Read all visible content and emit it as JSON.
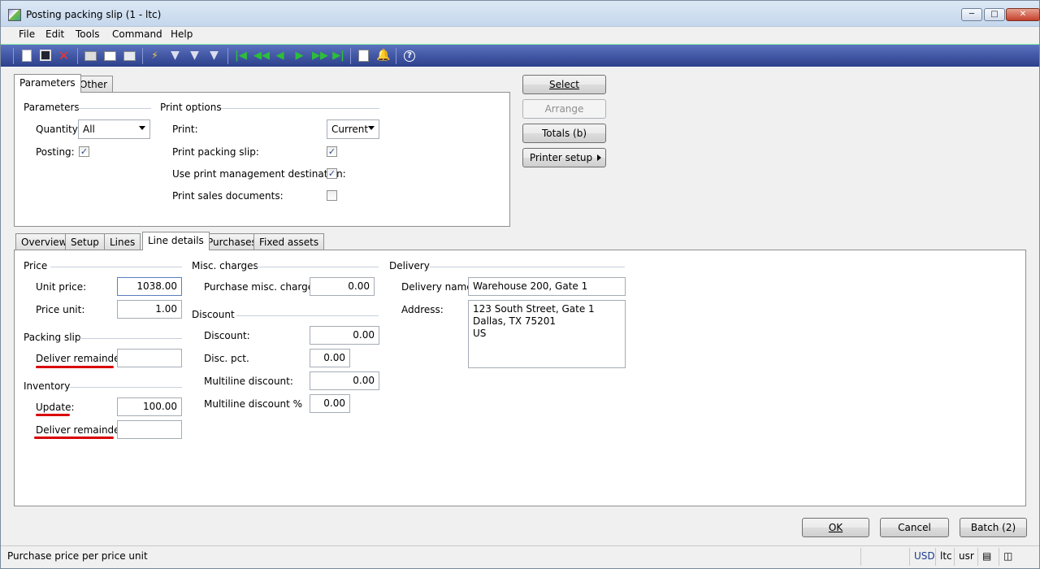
{
  "window": {
    "title": "Posting packing slip (1 - ltc)"
  },
  "menu": [
    "File",
    "Edit",
    "Tools",
    "Command",
    "Help"
  ],
  "top_tabs": {
    "parameters": "Parameters",
    "other": "Other"
  },
  "parameters": {
    "group_label": "Parameters",
    "quantity_label": "Quantity:",
    "quantity_value": "All",
    "posting_label": "Posting:",
    "posting_checked": true
  },
  "print_options": {
    "group_label": "Print options",
    "print_label": "Print:",
    "print_value": "Current",
    "print_packing_slip_label": "Print packing slip:",
    "print_packing_slip_checked": true,
    "use_print_mgmt_label": "Use print management destination:",
    "use_print_mgmt_checked": true,
    "print_sales_docs_label": "Print sales documents:",
    "print_sales_docs_checked": false
  },
  "side_buttons": {
    "select": "Select",
    "arrange": "Arrange",
    "totals": "Totals (b)",
    "printer_setup": "Printer setup"
  },
  "lower_tabs": [
    "Overview",
    "Setup",
    "Lines",
    "Line details",
    "Purchases",
    "Fixed assets"
  ],
  "line_details": {
    "price_group": "Price",
    "unit_price_label": "Unit price:",
    "unit_price_value": "1038.00",
    "price_unit_label": "Price unit:",
    "price_unit_value": "1.00",
    "packing_slip_group": "Packing slip",
    "ps_deliver_remainder_label": "Deliver remainder:",
    "ps_deliver_remainder_value": "",
    "inventory_group": "Inventory",
    "update_label": "Update:",
    "update_value": "100.00",
    "inv_deliver_remainder_label": "Deliver remainder:",
    "inv_deliver_remainder_value": "",
    "misc_group": "Misc. charges",
    "purchase_misc_label": "Purchase misc. charges:",
    "purchase_misc_value": "0.00",
    "discount_group": "Discount",
    "discount_label": "Discount:",
    "discount_value": "0.00",
    "disc_pct_label": "Disc. pct.",
    "disc_pct_value": "0.00",
    "multiline_discount_label": "Multiline discount:",
    "multiline_discount_value": "0.00",
    "multiline_discount_pct_label": "Multiline discount %",
    "multiline_discount_pct_value": "0.00",
    "delivery_group": "Delivery",
    "delivery_name_label": "Delivery name:",
    "delivery_name_value": "Warehouse 200, Gate 1",
    "address_label": "Address:",
    "address_value": "123 South Street, Gate 1\nDallas, TX 75201\nUS"
  },
  "bottom_buttons": {
    "ok": "OK",
    "cancel": "Cancel",
    "batch": "Batch (2)"
  },
  "status": {
    "help_text": "Purchase price per price unit",
    "currency": "USD",
    "company": "ltc",
    "user": "usr"
  },
  "colors": {
    "toolbar": "#2c3f8a",
    "highlight_underline": "#d90000"
  }
}
